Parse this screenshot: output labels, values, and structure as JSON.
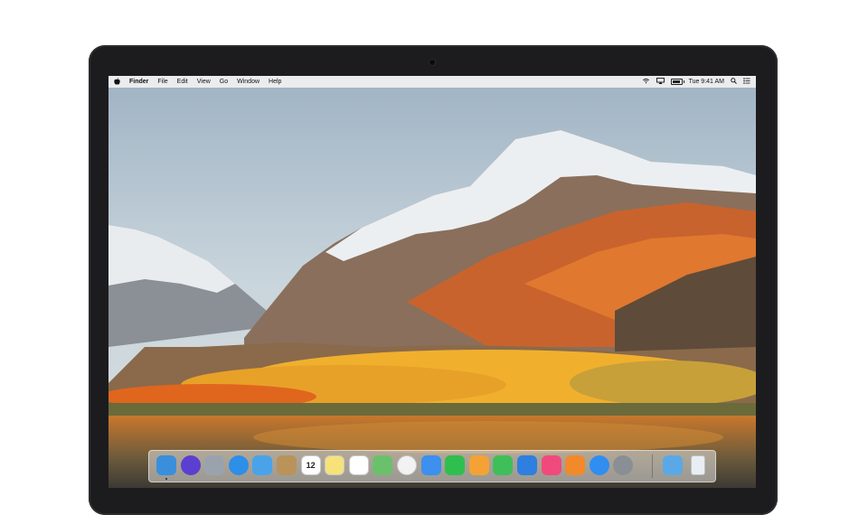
{
  "menubar": {
    "apple_glyph": "",
    "app_name": "Finder",
    "menus": [
      "File",
      "Edit",
      "View",
      "Go",
      "Window",
      "Help"
    ],
    "clock": "Tue 9:41 AM",
    "icons": [
      "wifi-icon",
      "airplay-icon",
      "battery-icon",
      "spotlight-search-icon",
      "notification-center-icon"
    ]
  },
  "dock": {
    "apps": [
      {
        "name": "finder-icon",
        "color": "#3a8fdc",
        "running": true
      },
      {
        "name": "siri-icon",
        "color": "#5b3fd1"
      },
      {
        "name": "launchpad-icon",
        "color": "#9aa3ad"
      },
      {
        "name": "safari-icon",
        "color": "#2d8fe8"
      },
      {
        "name": "mail-icon",
        "color": "#4aa3e8"
      },
      {
        "name": "contacts-icon",
        "color": "#b9935a"
      },
      {
        "name": "calendar-icon",
        "color": "#ffffff",
        "text": "12"
      },
      {
        "name": "notes-icon",
        "color": "#f7e27a"
      },
      {
        "name": "reminders-icon",
        "color": "#ffffff"
      },
      {
        "name": "maps-icon",
        "color": "#6bc16b"
      },
      {
        "name": "photos-icon",
        "color": "#f2f2f2"
      },
      {
        "name": "messages-icon",
        "color": "#3d8ff0"
      },
      {
        "name": "facetime-icon",
        "color": "#2fbf4f"
      },
      {
        "name": "pages-icon",
        "color": "#f4a235"
      },
      {
        "name": "numbers-icon",
        "color": "#3fbf59"
      },
      {
        "name": "keynote-icon",
        "color": "#2e7fe0"
      },
      {
        "name": "itunes-icon",
        "color": "#f04a7c"
      },
      {
        "name": "ibooks-icon",
        "color": "#f28a2a"
      },
      {
        "name": "app-store-icon",
        "color": "#2f8ef0"
      },
      {
        "name": "system-preferences-icon",
        "color": "#8a8f96"
      }
    ],
    "right_items": [
      {
        "name": "downloads-folder-icon",
        "color": "#5aa9e6"
      },
      {
        "name": "trash-icon",
        "color": "#e9eef2"
      }
    ]
  }
}
